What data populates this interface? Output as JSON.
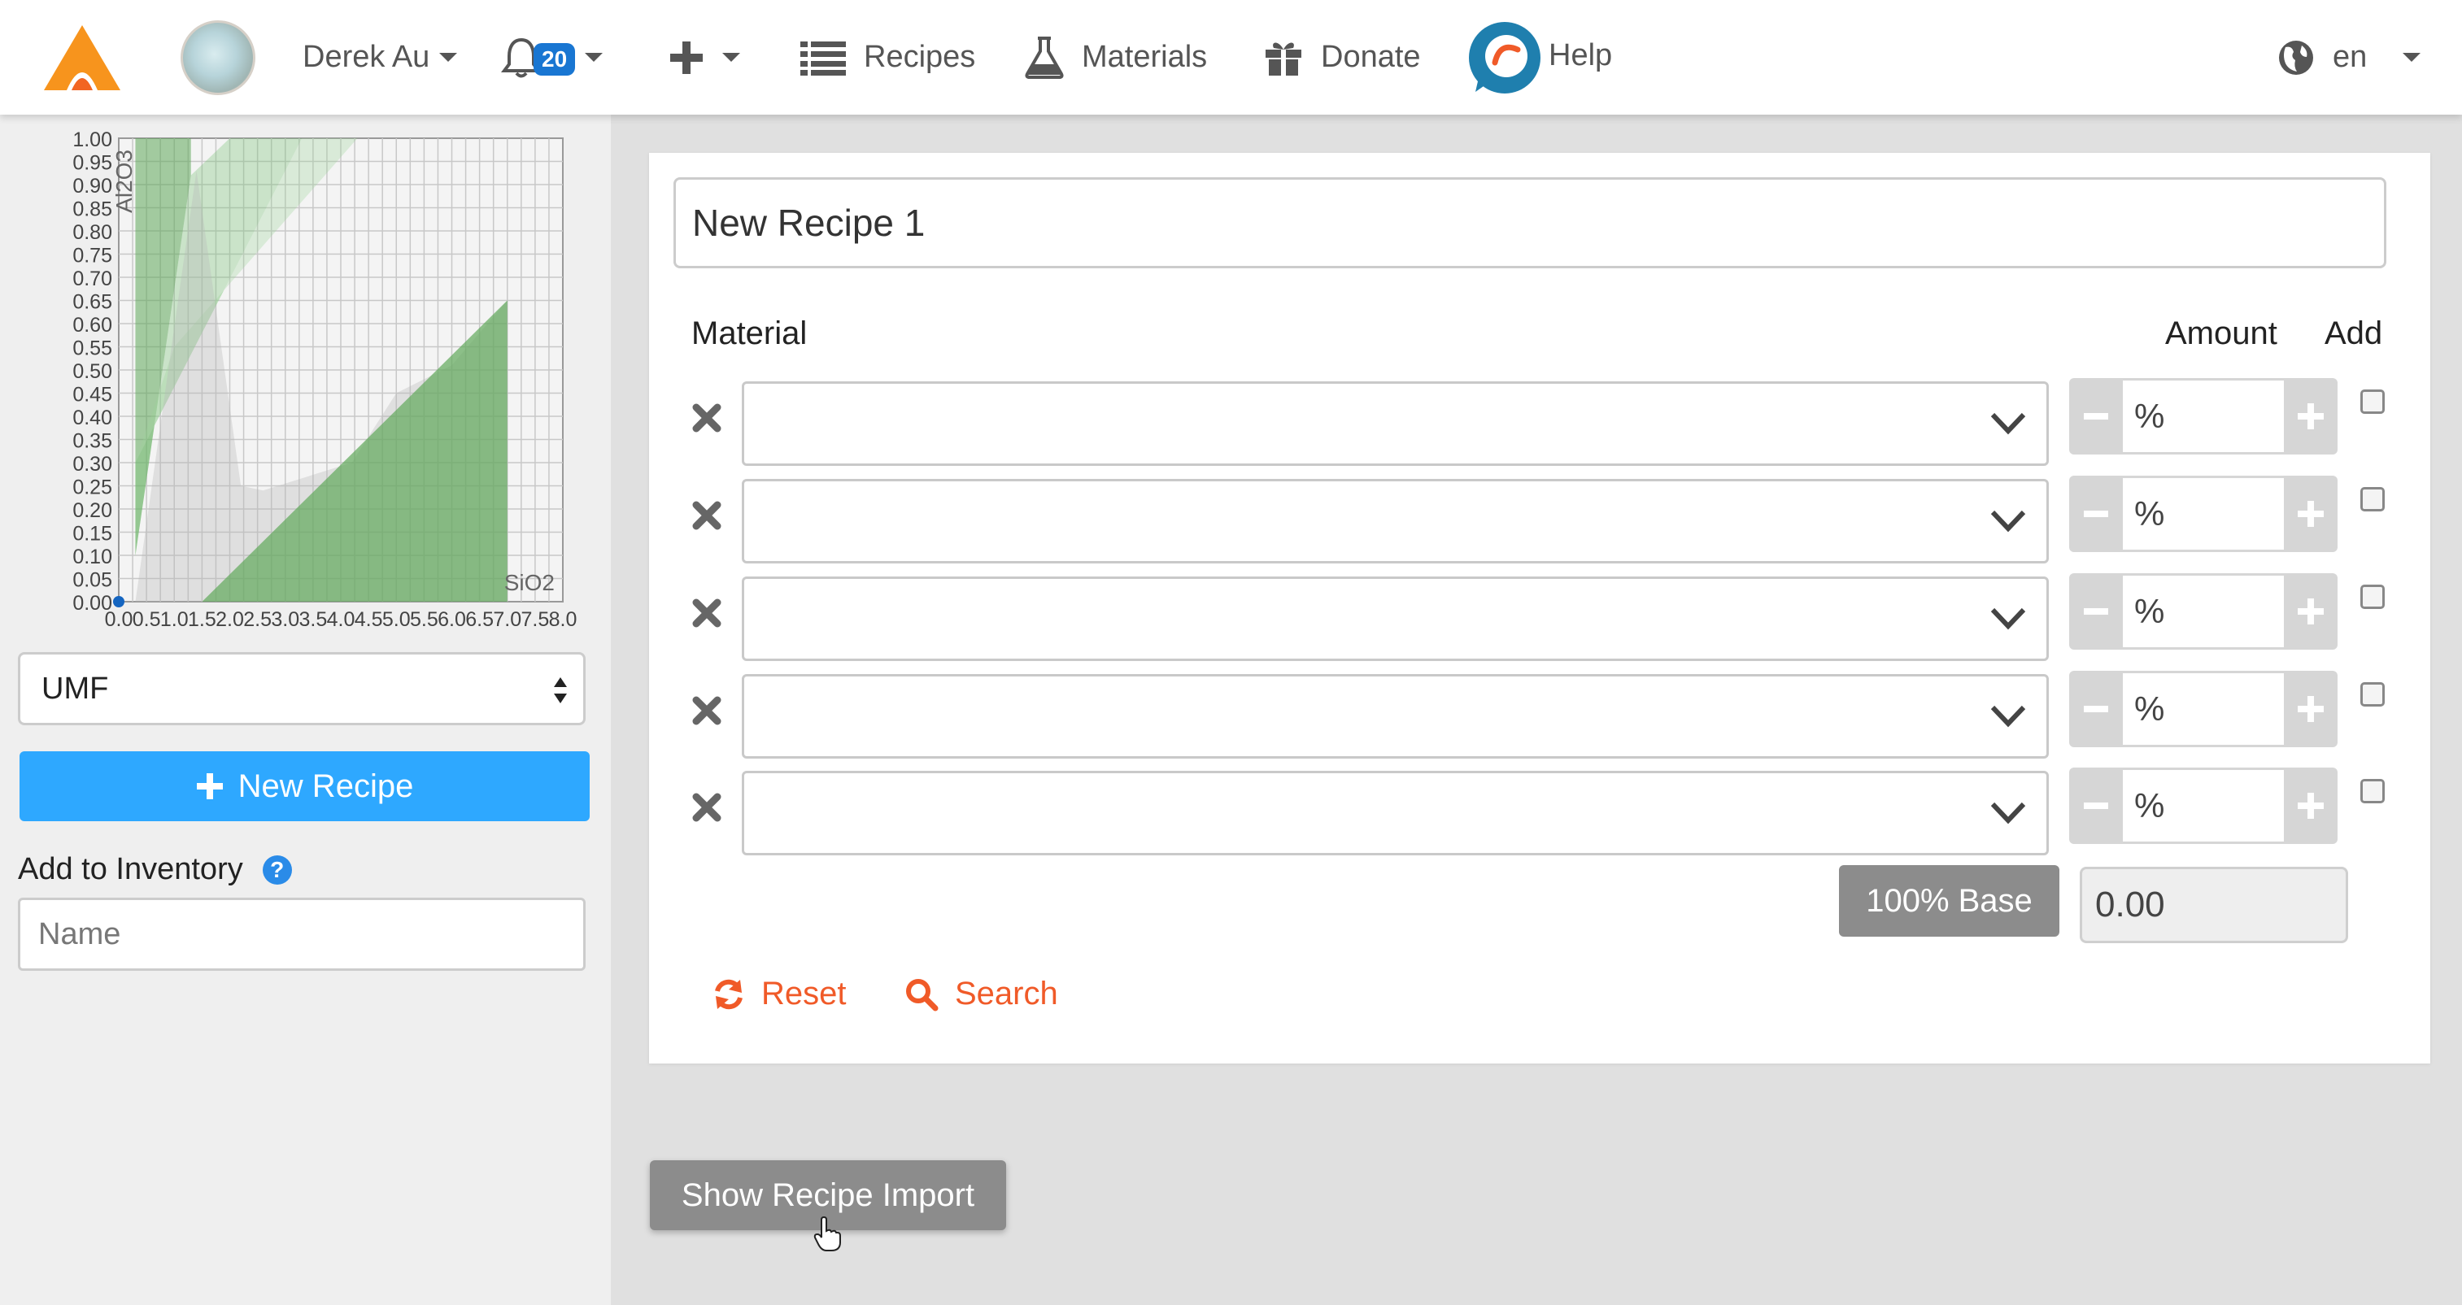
{
  "nav": {
    "user_name": "Derek Au",
    "notification_count": "20",
    "recipes_label": "Recipes",
    "materials_label": "Materials",
    "donate_label": "Donate",
    "help_label": "Help",
    "language": "en"
  },
  "chart_data": {
    "type": "area",
    "y_axis_label": "Al2O3",
    "x_axis_label": "SiO2",
    "y_ticks": [
      "1.00",
      "0.95",
      "0.90",
      "0.85",
      "0.80",
      "0.75",
      "0.70",
      "0.65",
      "0.60",
      "0.55",
      "0.50",
      "0.45",
      "0.40",
      "0.35",
      "0.30",
      "0.25",
      "0.20",
      "0.15",
      "0.10",
      "0.05",
      "0.00"
    ],
    "x_ticks": [
      "0.0",
      "0.5",
      "1.0",
      "1.5",
      "2.0",
      "2.5",
      "3.0",
      "3.5",
      "4.0",
      "4.5",
      "5.0",
      "5.5",
      "6.0",
      "6.5",
      "7.0",
      "7.5",
      "8.0"
    ],
    "xlim": [
      0,
      8
    ],
    "ylim": [
      0,
      1
    ],
    "grid": true,
    "regions": [
      {
        "color": "#5fa85a",
        "opacity": 0.55,
        "points": [
          [
            0.3,
            1.0
          ],
          [
            1.3,
            1.0
          ],
          [
            1.3,
            0.92
          ],
          [
            0.3,
            0.1
          ]
        ]
      },
      {
        "color": "#7cc278",
        "opacity": 0.35,
        "points": [
          [
            0.3,
            0.1
          ],
          [
            1.3,
            0.92
          ],
          [
            2.0,
            1.0
          ],
          [
            3.3,
            1.0
          ],
          [
            0.3,
            0.3
          ]
        ]
      },
      {
        "color": "#9bd597",
        "opacity": 0.3,
        "points": [
          [
            0.3,
            0.3
          ],
          [
            3.3,
            1.0
          ],
          [
            4.3,
            1.0
          ],
          [
            1.0,
            0.55
          ]
        ]
      },
      {
        "color": "#b8b8b8",
        "opacity": 0.35,
        "points": [
          [
            1.4,
            0.93
          ],
          [
            2.2,
            0.25
          ],
          [
            2.6,
            0.24
          ],
          [
            4.2,
            0.3
          ],
          [
            5.0,
            0.45
          ],
          [
            6.0,
            0.51
          ],
          [
            7.0,
            0.65
          ],
          [
            7.0,
            0.0
          ],
          [
            0.3,
            0.0
          ]
        ]
      },
      {
        "color": "#5fa85a",
        "opacity": 0.7,
        "points": [
          [
            1.5,
            0.0
          ],
          [
            7.0,
            0.65
          ],
          [
            7.0,
            0.0
          ]
        ]
      }
    ],
    "point": [
      0.0,
      0.0
    ]
  },
  "sidebar": {
    "unit_select": "UMF",
    "new_recipe_label": "New Recipe",
    "inventory_label": "Add to Inventory",
    "inventory_help": "?",
    "name_placeholder": "Name"
  },
  "recipe": {
    "title": "New Recipe 1",
    "material_header": "Material",
    "amount_header": "Amount",
    "add_header": "Add",
    "rows": [
      {
        "unit": "%"
      },
      {
        "unit": "%"
      },
      {
        "unit": "%"
      },
      {
        "unit": "%"
      },
      {
        "unit": "%"
      }
    ],
    "base_label": "100% Base",
    "base_value": "0.00",
    "reset_label": "Reset",
    "search_label": "Search"
  },
  "import_label": "Show Recipe Import",
  "colors": {
    "accent_blue": "#2ea8ff",
    "accent_orange": "#f05a28",
    "logo_orange": "#f7941d",
    "badge_blue": "#1976d2",
    "grey_button": "#8c8c8c"
  }
}
